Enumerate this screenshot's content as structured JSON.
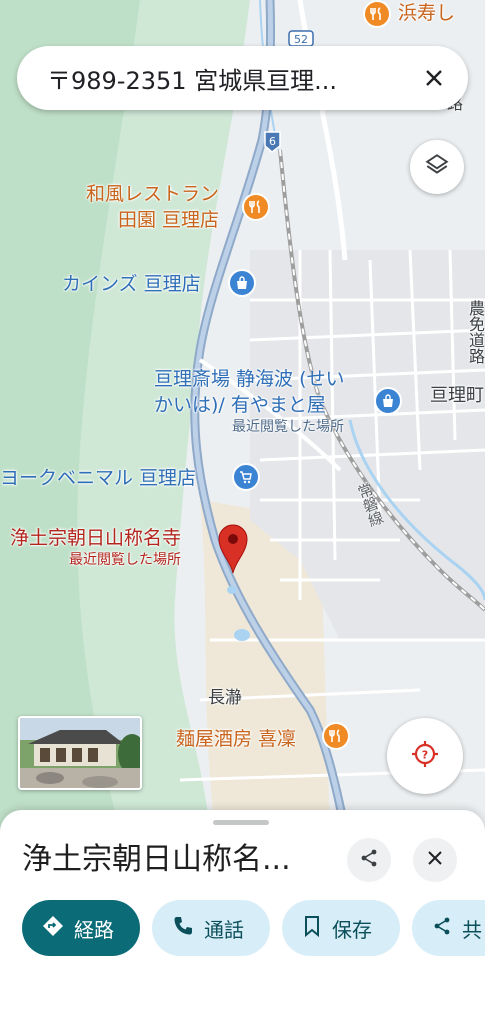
{
  "search": {
    "query": "〒989-2351 宮城県亘理...",
    "clear_icon": "close-icon"
  },
  "map": {
    "road_shields": [
      "6",
      "52"
    ],
    "labels": {
      "hamazushi": "浜寿し",
      "wafu_line1": "和風レストラン",
      "wafu_line2": "田園 亘理店",
      "cainz": "カインズ 亘理店",
      "saijo_line1": "亘理斎場 静海波 (せい",
      "saijo_line2": "かいは)/ 有やまと屋",
      "saijo_sub": "最近閲覧した場所",
      "yorkbenimaru": "ヨークベニマル 亘理店",
      "shomyoji": "浄土宗朝日山称名寺",
      "shomyoji_sub": "最近閲覧した場所",
      "nagatoro": "長瀞",
      "kirin": "麺屋酒房 喜凜",
      "watari_edge": "亘理町",
      "joban_line": "常磐線",
      "nosho_road": "農免道路",
      "road_edge": "路"
    }
  },
  "controls": {
    "layers_icon": "layers-icon",
    "location_icon": "my-location-icon"
  },
  "place_sheet": {
    "title": "浄土宗朝日山称名...",
    "share_icon": "share-icon",
    "close_icon": "close-icon",
    "actions": {
      "directions": "経路",
      "call": "通話",
      "save": "保存",
      "share": "共"
    }
  },
  "colors": {
    "accent": "#0b6b77",
    "chip_bg": "#d7eef8",
    "pin_red": "#d93025",
    "poi_orange": "#f08a24",
    "poi_blue": "#3b84d4"
  }
}
